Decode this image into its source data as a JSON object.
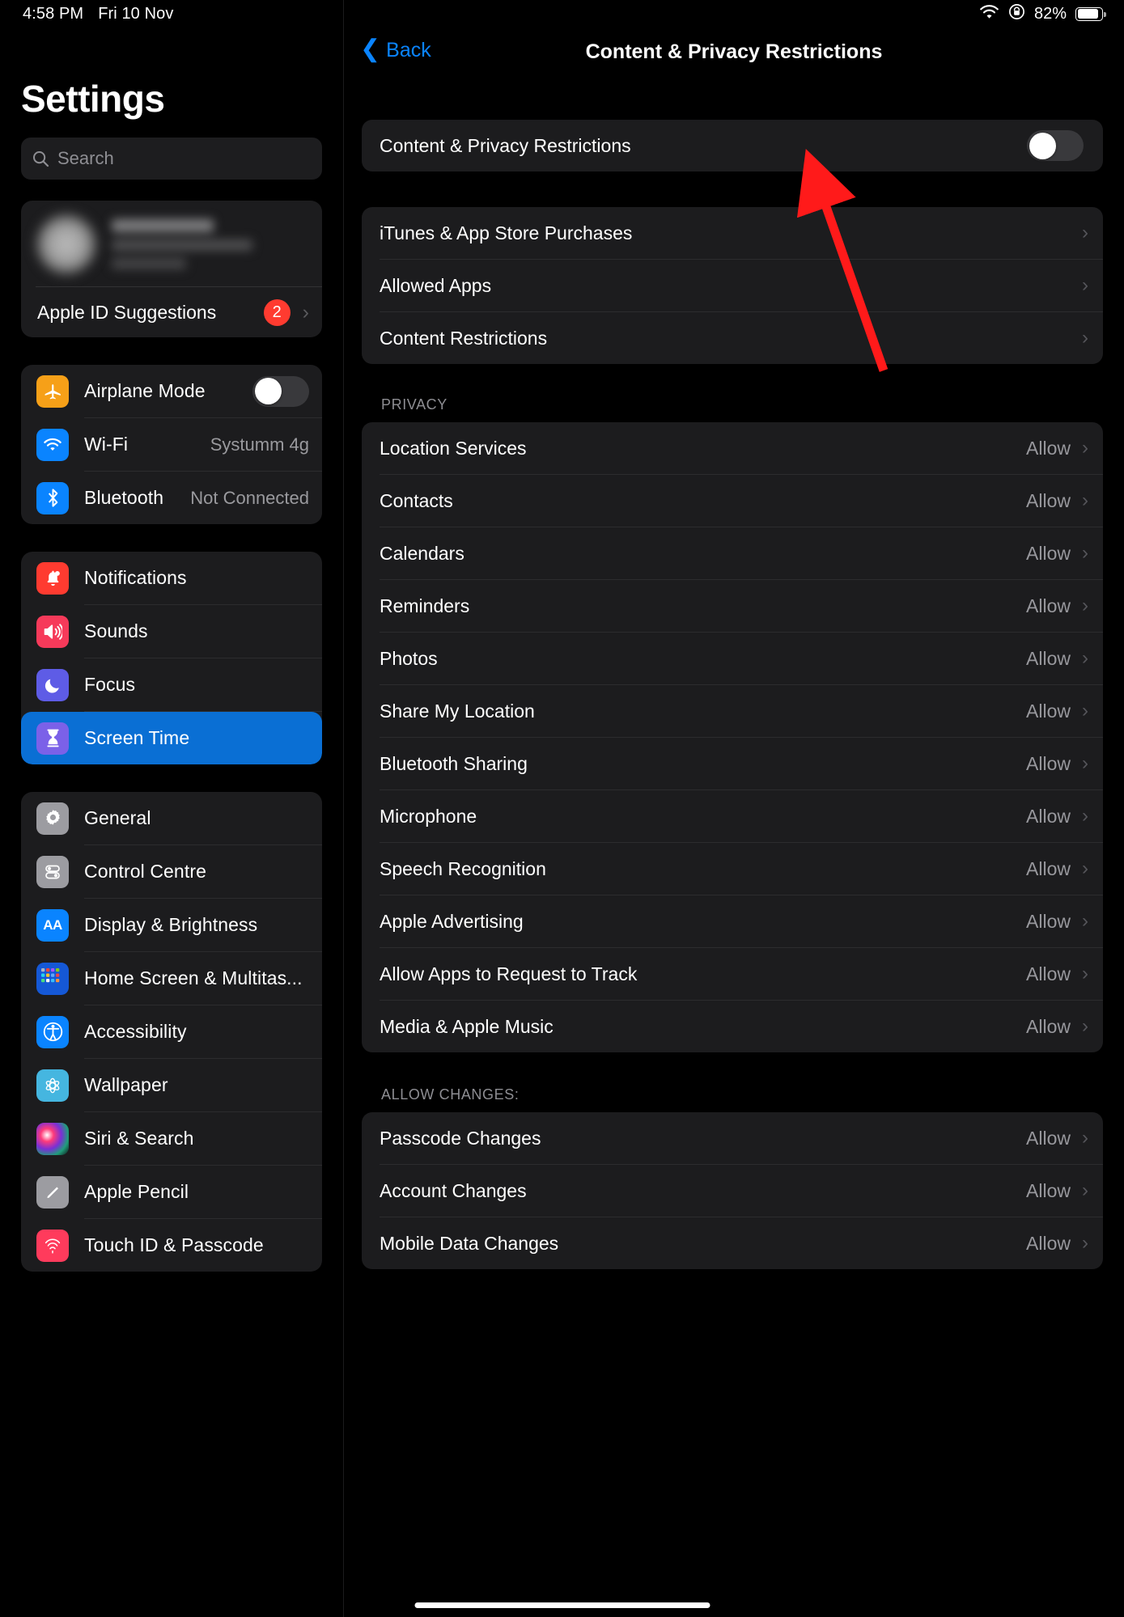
{
  "status_bar": {
    "time": "4:58 PM",
    "date": "Fri 10 Nov",
    "wifi_icon": "wifi-icon",
    "rotation_lock_icon": "rotation-lock-icon",
    "battery_percent": "82%",
    "battery_icon": "battery-icon"
  },
  "sidebar": {
    "title": "Settings",
    "search": {
      "placeholder": "Search",
      "icon": "search-icon"
    },
    "apple_id": {
      "name_blurred": "",
      "subtitle_blurred": "",
      "suggestions_label": "Apple ID Suggestions",
      "suggestions_badge": "2"
    },
    "groups": [
      {
        "id": "connectivity",
        "items": [
          {
            "label": "Airplane Mode",
            "icon": "airplane-icon",
            "control": "toggle",
            "toggle_on": false,
            "value": ""
          },
          {
            "label": "Wi-Fi",
            "icon": "wifi-icon",
            "control": "value",
            "value": "Systumm 4g"
          },
          {
            "label": "Bluetooth",
            "icon": "bluetooth-icon",
            "control": "value",
            "value": "Not Connected"
          }
        ]
      },
      {
        "id": "system",
        "items": [
          {
            "label": "Notifications",
            "icon": "bell-icon",
            "control": "none",
            "value": ""
          },
          {
            "label": "Sounds",
            "icon": "speaker-icon",
            "control": "none",
            "value": ""
          },
          {
            "label": "Focus",
            "icon": "moon-icon",
            "control": "none",
            "value": ""
          },
          {
            "label": "Screen Time",
            "icon": "hourglass-icon",
            "control": "none",
            "value": "",
            "selected": true
          }
        ]
      },
      {
        "id": "preferences",
        "items": [
          {
            "label": "General",
            "icon": "gear-icon",
            "control": "none",
            "value": ""
          },
          {
            "label": "Control Centre",
            "icon": "control-centre-icon",
            "control": "none",
            "value": ""
          },
          {
            "label": "Display & Brightness",
            "icon": "display-brightness-icon",
            "control": "none",
            "value": ""
          },
          {
            "label": "Home Screen & Multitas...",
            "icon": "home-screen-icon",
            "control": "none",
            "value": ""
          },
          {
            "label": "Accessibility",
            "icon": "accessibility-icon",
            "control": "none",
            "value": ""
          },
          {
            "label": "Wallpaper",
            "icon": "wallpaper-icon",
            "control": "none",
            "value": ""
          },
          {
            "label": "Siri & Search",
            "icon": "siri-icon",
            "control": "none",
            "value": ""
          },
          {
            "label": "Apple Pencil",
            "icon": "apple-pencil-icon",
            "control": "none",
            "value": ""
          },
          {
            "label": "Touch ID & Passcode",
            "icon": "touch-id-icon",
            "control": "none",
            "value": ""
          }
        ]
      }
    ]
  },
  "detail": {
    "back_label": "Back",
    "title": "Content & Privacy Restrictions",
    "master_toggle": {
      "label": "Content & Privacy Restrictions",
      "on": false
    },
    "restrictions_group": [
      {
        "label": "iTunes & App Store Purchases",
        "value": ""
      },
      {
        "label": "Allowed Apps",
        "value": ""
      },
      {
        "label": "Content Restrictions",
        "value": ""
      }
    ],
    "privacy_header": "PRIVACY",
    "privacy_group": [
      {
        "label": "Location Services",
        "value": "Allow"
      },
      {
        "label": "Contacts",
        "value": "Allow"
      },
      {
        "label": "Calendars",
        "value": "Allow"
      },
      {
        "label": "Reminders",
        "value": "Allow"
      },
      {
        "label": "Photos",
        "value": "Allow"
      },
      {
        "label": "Share My Location",
        "value": "Allow"
      },
      {
        "label": "Bluetooth Sharing",
        "value": "Allow"
      },
      {
        "label": "Microphone",
        "value": "Allow"
      },
      {
        "label": "Speech Recognition",
        "value": "Allow"
      },
      {
        "label": "Apple Advertising",
        "value": "Allow"
      },
      {
        "label": "Allow Apps to Request to Track",
        "value": "Allow"
      },
      {
        "label": "Media & Apple Music",
        "value": "Allow"
      }
    ],
    "allow_changes_header": "ALLOW CHANGES:",
    "allow_changes_group": [
      {
        "label": "Passcode Changes",
        "value": "Allow"
      },
      {
        "label": "Account Changes",
        "value": "Allow"
      },
      {
        "label": "Mobile Data Changes",
        "value": "Allow"
      }
    ]
  },
  "annotation": {
    "type": "arrow",
    "color": "#ff1a1a",
    "points_to": "master-toggle"
  },
  "colors": {
    "accent_blue": "#0a84ff",
    "selected_row": "#0a6fd4",
    "badge_red": "#ff3b30",
    "card_bg": "#1c1c1e",
    "page_bg": "#000000",
    "secondary_text": "#98989d"
  }
}
